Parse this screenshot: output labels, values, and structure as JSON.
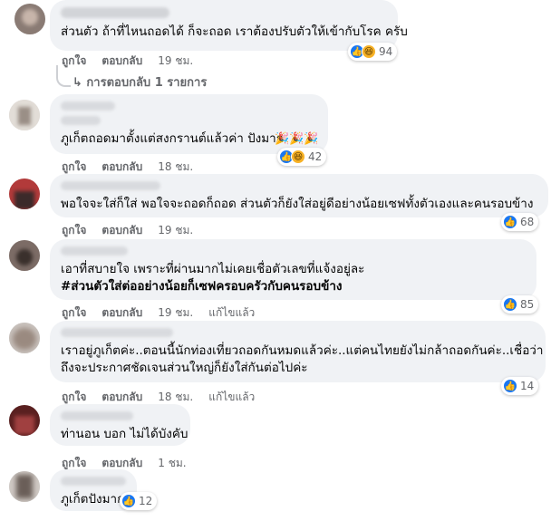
{
  "comments": [
    {
      "text": "ส่วนตัว ถ้าที่ไหนถอดได้ ก็จะถอด เราต้องปรับตัวให้เข้ากับโรค ครับ",
      "like_label": "ถูกใจ",
      "reply_label": "ตอบกลับ",
      "time": "19 ชม.",
      "reaction_count": "94",
      "reaction_icons": [
        "like-icon",
        "haha-icon"
      ],
      "replies": "การตอบกลับ 1 รายการ"
    },
    {
      "text": "ภูเก็ตถอดมาตั้งแต่สงกรานต์แล้วค่า ปังมาก",
      "emoji": "🎉🎉🎉",
      "like_label": "ถูกใจ",
      "reply_label": "ตอบกลับ",
      "time": "18 ชม.",
      "reaction_count": "42",
      "reaction_icons": [
        "like-icon",
        "haha-icon"
      ]
    },
    {
      "text": "พอใจจะใส่ก็ใส่ พอใจจะถอดก็ถอด ส่วนตัวก็ยังใส่อยู่ดีอย่างน้อยเซฟทั้งตัวเองและคนรอบข้าง",
      "like_label": "ถูกใจ",
      "reply_label": "ตอบกลับ",
      "time": "19 ชม.",
      "reaction_count": "68",
      "reaction_icons": [
        "like-icon"
      ]
    },
    {
      "line1": "เอาที่สบายใจ เพราะที่ผ่านมากไม่เคยเชื่อตัวเลขที่แจ้งอยู่ละ",
      "line2": "#ส่วนตัวใส่ต่ออย่างน้อยก็เซฟครอบครัวกับคนรอบข้าง",
      "like_label": "ถูกใจ",
      "reply_label": "ตอบกลับ",
      "time": "19 ชม.",
      "edited": "แก้ไขแล้ว",
      "reaction_count": "85",
      "reaction_icons": [
        "like-icon"
      ]
    },
    {
      "line1": "เราอยู่ภูเก็ตค่ะ..ตอนนี้นักท่องเที่ยวถอดกันหมดแล้วค่ะ..แต่คนไทยยังไม่กล้าถอดกันค่ะ..เชื่อว่า",
      "line2": "ถึงจะประกาศชัดเจนส่วนใหญ่ก็ยังใส่กันต่อไปค่ะ",
      "like_label": "ถูกใจ",
      "reply_label": "ตอบกลับ",
      "time": "18 ชม.",
      "edited": "แก้ไขแล้ว",
      "reaction_count": "14",
      "reaction_icons": [
        "like-icon"
      ]
    },
    {
      "text": "ท่านอน บอก ไม่ได้บังคับ",
      "like_label": "ถูกใจ",
      "reply_label": "ตอบกลับ",
      "time": "1 ชม."
    },
    {
      "text": "ภูเก็ตปังมาก",
      "reaction_count": "12",
      "reaction_icons": [
        "like-icon"
      ]
    }
  ]
}
